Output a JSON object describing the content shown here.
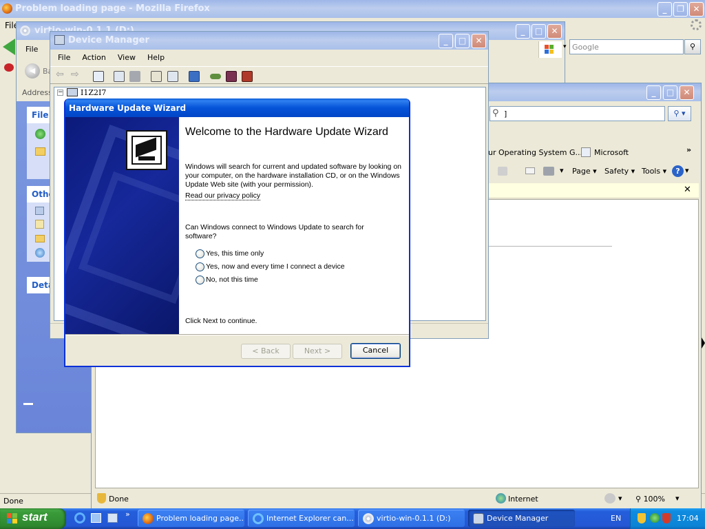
{
  "firefox": {
    "title": "Problem loading page - Mozilla Firefox",
    "menu_file": "File",
    "status": "Done"
  },
  "explorer": {
    "title": "virtio-win-0.1.1 (D:)",
    "menu_file": "File",
    "address_label": "Address",
    "back_label": "Back",
    "panel_file": "File",
    "panel_other": "Othe",
    "panel_details": "Deta"
  },
  "ie": {
    "search_placeholder": "Google",
    "search_box_text": "]",
    "favorites": [
      "ur Operating System G...",
      "Microsoft"
    ],
    "cmd_page": "Page",
    "cmd_safety": "Safety",
    "cmd_tools": "Tools",
    "status_done": "Done",
    "status_zone": "Internet",
    "zoom": "100%"
  },
  "devmgr": {
    "title": "Device Manager",
    "menu": [
      "File",
      "Action",
      "View",
      "Help"
    ],
    "tree_root": "I1Z2I7"
  },
  "wizard": {
    "title": "Hardware Update Wizard",
    "heading": "Welcome to the Hardware Update Wizard",
    "intro": "Windows will search for current and updated software by looking on your computer, on the hardware installation CD, or on the Windows Update Web site (with your permission).",
    "privacy_link": "Read our privacy policy",
    "question": "Can Windows connect to Windows Update to search for software?",
    "options": [
      "Yes, this time only",
      "Yes, now and every time I connect a device",
      "No, not this time"
    ],
    "hint": "Click Next to continue.",
    "back": "< Back",
    "next": "Next >",
    "cancel": "Cancel"
  },
  "taskbar": {
    "start": "start",
    "tasks": [
      "Problem loading page...",
      "Internet Explorer can...",
      "virtio-win-0.1.1 (D:)",
      "Device Manager"
    ],
    "lang": "EN",
    "clock": "17:04"
  },
  "colors": {
    "xp_blue": "#0553d8",
    "taskbar": "#245edb",
    "start_green": "#3a9b3a",
    "dialog_face": "#ece9d8"
  }
}
